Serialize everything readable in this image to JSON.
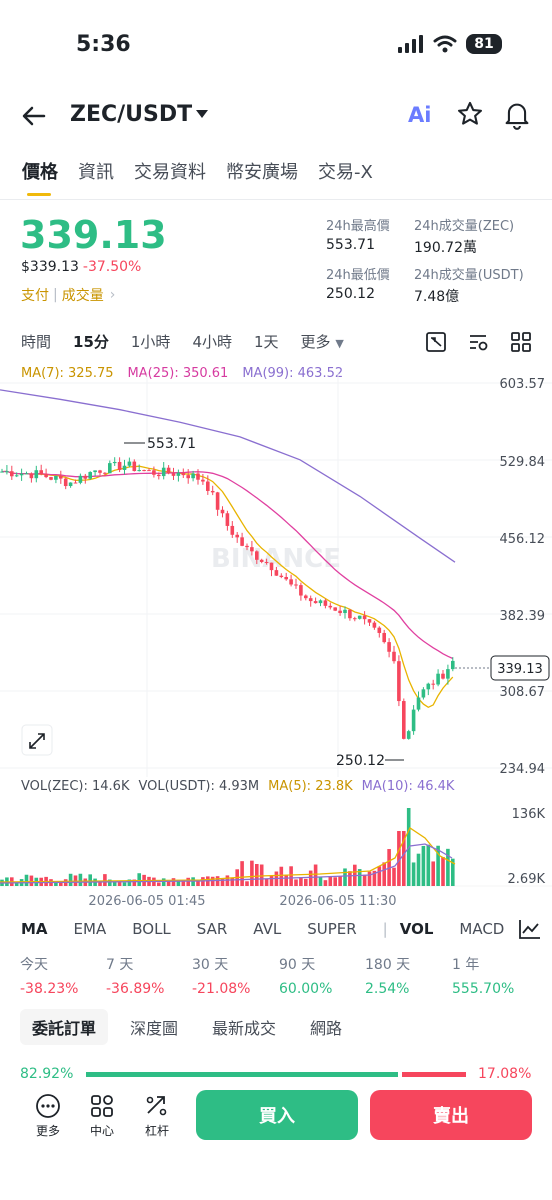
{
  "status_bar": {
    "time": "5:36",
    "battery": "81"
  },
  "header": {
    "pair": "ZEC/USDT",
    "ai_label": "Ai"
  },
  "tabs": [
    "價格",
    "資訊",
    "交易資料",
    "幣安廣場",
    "交易-X"
  ],
  "price": {
    "last": "339.13",
    "usd": "$339.13",
    "change": "-37.50%",
    "pay": "支付",
    "volume_link": "成交量",
    "high_label": "24h最高價",
    "high": "553.71",
    "vol_zec_label": "24h成交量(ZEC)",
    "vol_zec": "190.72萬",
    "low_label": "24h最低價",
    "low": "250.12",
    "vol_usdt_label": "24h成交量(USDT)",
    "vol_usdt": "7.48億"
  },
  "intervals": [
    "時間",
    "15分",
    "1小時",
    "4小時",
    "1天",
    "更多"
  ],
  "ma_legend": {
    "ma7": "MA(7): 325.75",
    "ma25": "MA(25): 350.61",
    "ma99": "MA(99): 463.52"
  },
  "vol_legend": {
    "vol_zec": "VOL(ZEC): 14.6K",
    "vol_usdt": "VOL(USDT): 4.93M",
    "ma5": "MA(5): 23.8K",
    "ma10": "MA(10): 46.4K"
  },
  "colors": {
    "up": "#2ebd85",
    "down": "#f6465d",
    "ma7": "#e8b400",
    "ma25": "#e040a0",
    "ma99": "#8a6fd0",
    "accent": "#f0b90b"
  },
  "chart_data": {
    "type": "candlestick",
    "y_axis_ticks": [
      "603.57",
      "529.84",
      "456.12",
      "382.39",
      "308.67",
      "234.94"
    ],
    "volume_axis_ticks": [
      "136K",
      "2.69K"
    ],
    "x_axis_ticks": [
      "2026-06-05 01:45",
      "2026-06-05 11:30"
    ],
    "ylim": [
      234.94,
      603.57
    ],
    "current_price_label": "339.13",
    "high_marker": "553.71",
    "low_marker": "250.12",
    "watermark": "BINANCE",
    "ma7_last": 325.75,
    "ma25_last": 350.61,
    "ma99_last": 463.52
  },
  "indicators": [
    "MA",
    "EMA",
    "BOLL",
    "SAR",
    "AVL",
    "SUPER",
    "VOL",
    "MACD"
  ],
  "performance": [
    {
      "label": "今天",
      "value": "-38.23%",
      "dir": "down"
    },
    {
      "label": "7 天",
      "value": "-36.89%",
      "dir": "down"
    },
    {
      "label": "30 天",
      "value": "-21.08%",
      "dir": "down"
    },
    {
      "label": "90 天",
      "value": "60.00%",
      "dir": "up"
    },
    {
      "label": "180 天",
      "value": "2.54%",
      "dir": "up"
    },
    {
      "label": "1 年",
      "value": "555.70%",
      "dir": "up"
    }
  ],
  "order_tabs": [
    "委託訂單",
    "深度圖",
    "最新成交",
    "網路"
  ],
  "book_ratio": {
    "buy": "82.92%",
    "sell": "17.08%"
  },
  "bottom_nav": {
    "more": "更多",
    "center": "中心",
    "leverage": "杠杆",
    "buy": "買入",
    "sell": "賣出"
  }
}
